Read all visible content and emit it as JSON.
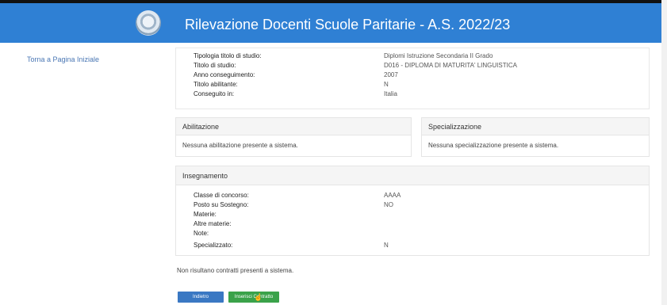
{
  "header": {
    "title": "Rilevazione Docenti Scuole Paritarie - A.S. 2022/23"
  },
  "sidebar": {
    "back_link": "Torna a Pagina Iniziale"
  },
  "titolo": {
    "rows": [
      {
        "label": "Tipologia titolo di studio:",
        "value": "Diplomi Istruzione Secondaria II Grado"
      },
      {
        "label": "Titolo di studio:",
        "value": "D016 - DIPLOMA DI MATURITA' LINGUISTICA"
      },
      {
        "label": "Anno conseguimento:",
        "value": "2007"
      },
      {
        "label": "Titolo abilitante:",
        "value": "N"
      },
      {
        "label": "Conseguito in:",
        "value": "Italia"
      }
    ]
  },
  "abilitazione": {
    "heading": "Abilitazione",
    "message": "Nessuna abilitazione presente a sistema."
  },
  "specializzazione": {
    "heading": "Specializzazione",
    "message": "Nessuna specializzazione presente a sistema."
  },
  "insegnamento": {
    "heading": "Insegnamento",
    "rows": [
      {
        "label": "Classe di concorso:",
        "value": "AAAA"
      },
      {
        "label": "Posto su Sostegno:",
        "value": "NO"
      },
      {
        "label": "Materie:",
        "value": ""
      },
      {
        "label": "Altre materie:",
        "value": ""
      },
      {
        "label": "Note:",
        "value": ""
      },
      {
        "label": "Specializzato:",
        "value": "N"
      }
    ]
  },
  "contratti": {
    "message": "Non risultano contratti presenti a sistema."
  },
  "buttons": {
    "back_label": "Indietro",
    "insert_label": "Inserisci Contratto"
  },
  "colors": {
    "header": "#2f80d4",
    "back_button": "#3a78c3",
    "insert_button": "#3aa24a"
  }
}
